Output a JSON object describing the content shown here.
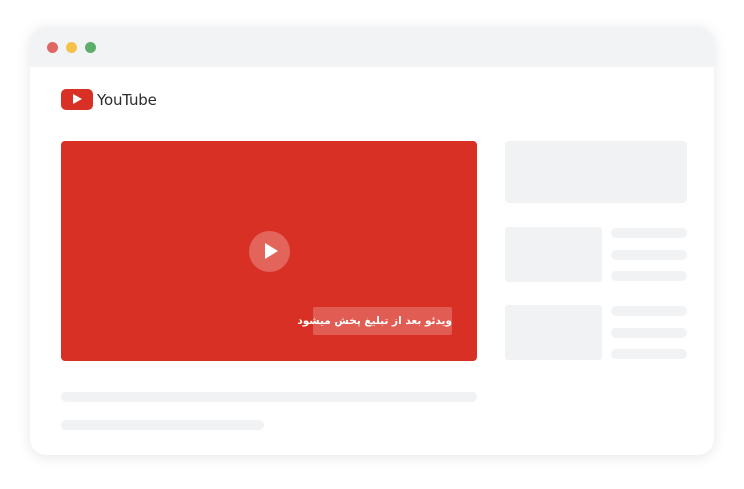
{
  "window": {
    "controls": [
      "close",
      "minimize",
      "maximize"
    ]
  },
  "logo": {
    "icon": "youtube-play-icon",
    "text": "YouTube"
  },
  "player": {
    "play_icon": "play-icon",
    "ad_notice": "ویدئو بعد از تبلیغ پخش میشود"
  },
  "colors": {
    "accent": "#d93025",
    "titlebar": "#f2f3f5",
    "placeholder": "#f1f2f4",
    "dot_close": "#e06666",
    "dot_minimize": "#f5c14b",
    "dot_maximize": "#5fad6a"
  }
}
